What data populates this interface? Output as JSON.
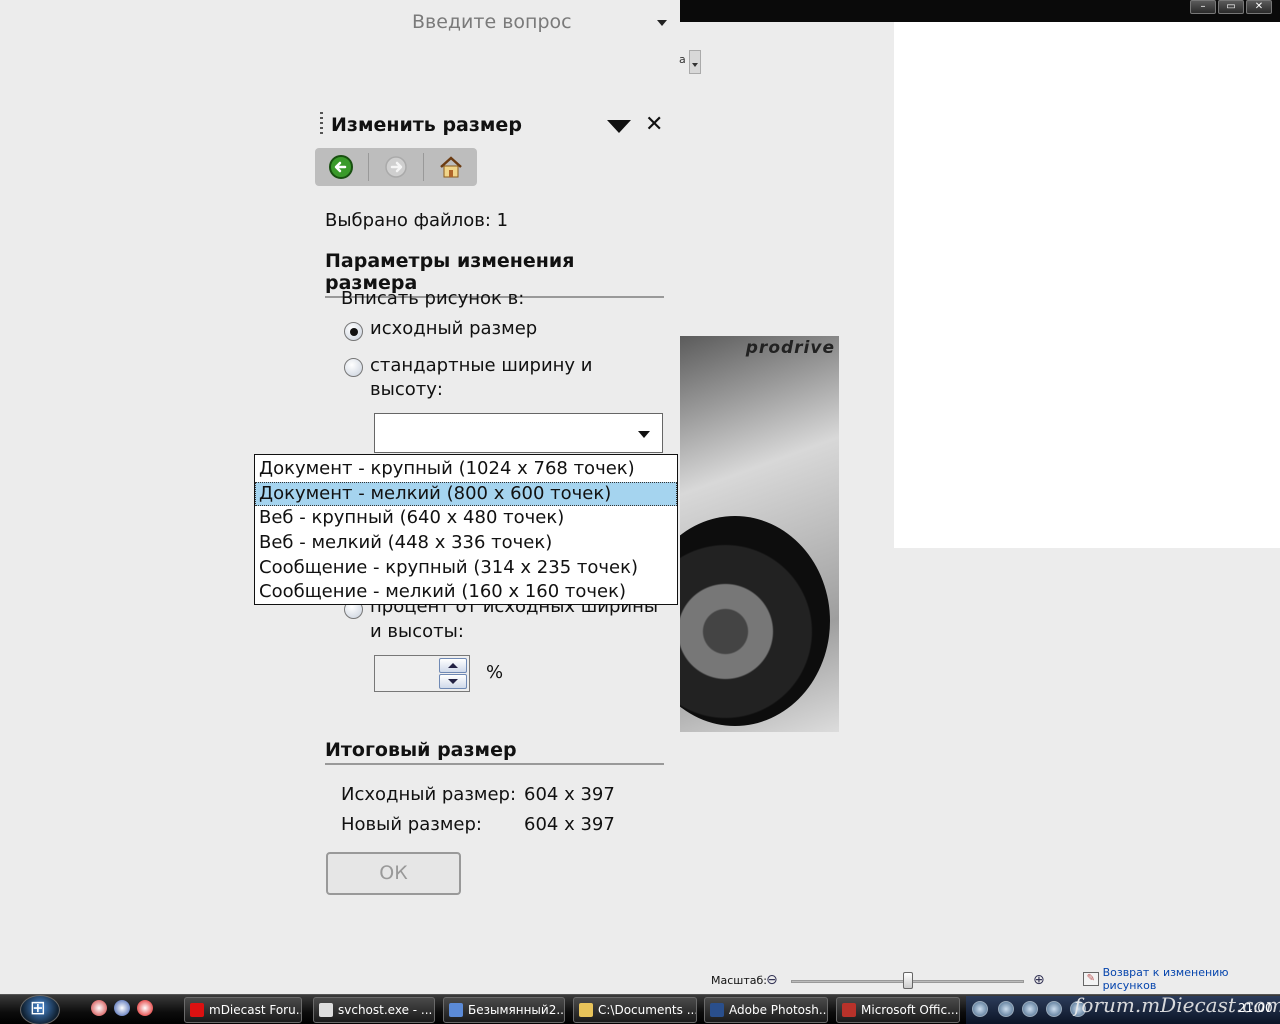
{
  "window": {
    "question_placeholder": "Введите вопрос",
    "controls": [
      "–",
      "▭",
      "✕"
    ],
    "truncated_label": "а"
  },
  "photo": {
    "logo_text": "prodrive"
  },
  "pane": {
    "title": "Изменить размер",
    "nav_icons": [
      "back-arrow-icon",
      "forward-arrow-icon",
      "home-icon"
    ],
    "files_selected": "Выбрано файлов: 1",
    "params_header": "Параметры изменения размера",
    "fit_label": "Вписать рисунок в:",
    "option_original": "исходный размер",
    "option_standard_line1": "стандартные ширину и",
    "option_standard_line2": "высоту:",
    "dropdown_options": [
      "Документ - крупный (1024 x 768 точек)",
      "Документ - мелкий (800 x 600 точек)",
      "Веб - крупный (640 x 480 точек)",
      "Веб - мелкий (448 x 336 точек)",
      "Сообщение - крупный (314 x 235 точек)",
      "Сообщение - мелкий (160 x 160 точек)"
    ],
    "selected_option_index": 1,
    "option_percent_line1": "процент от исходных ширины",
    "option_percent_line2": "и высоты:",
    "percent_value": "",
    "percent_sign": "%",
    "result_header": "Итоговый размер",
    "original_size_label": "Исходный размер:",
    "original_size_value": "604 x 397",
    "new_size_label": "Новый размер:",
    "new_size_value": "604 x 397",
    "ok_label": "ОК"
  },
  "status": {
    "zoom_label": "Масштаб:",
    "zoom_level": 0.5,
    "back_link": "Возврат к изменению рисунков"
  },
  "taskbar": {
    "tasks": [
      {
        "label": "mDiecast Foru...",
        "icon_color": "#d11"
      },
      {
        "label": "svchost.exe - ...",
        "icon_color": "#ddd"
      },
      {
        "label": "Безымянный2....",
        "icon_color": "#5b8ad6"
      },
      {
        "label": "C:\\Documents ...",
        "icon_color": "#e8c35a"
      },
      {
        "label": "Adobe Photosh...",
        "icon_color": "#2a4f8c"
      },
      {
        "label": "Microsoft Offic...",
        "icon_color": "#b8322a"
      }
    ],
    "watermark": "forum.mDiecast.com",
    "clock": "21:00"
  }
}
